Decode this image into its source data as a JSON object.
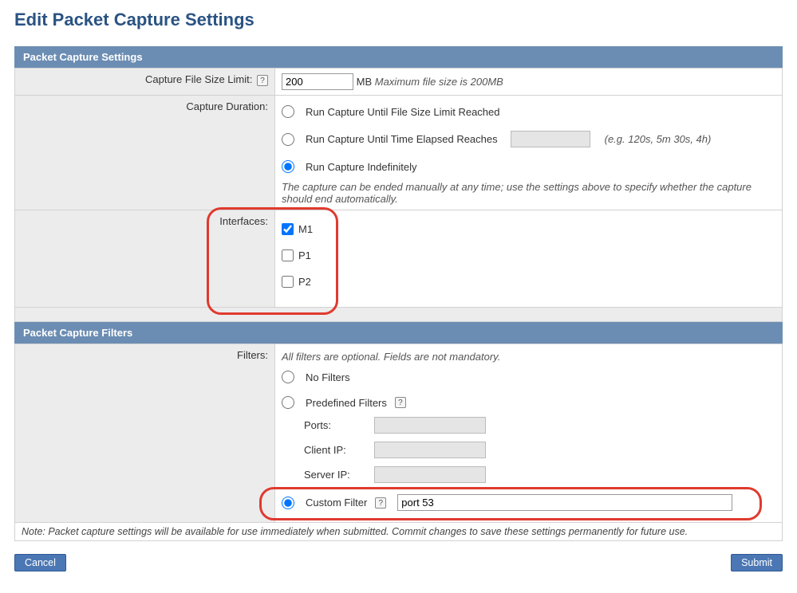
{
  "page": {
    "title": "Edit Packet Capture Settings"
  },
  "sections": {
    "settings_header": "Packet Capture Settings",
    "filters_header": "Packet Capture Filters"
  },
  "file_size": {
    "label": "Capture File Size Limit:",
    "value": "200",
    "unit": "MB",
    "hint": "Maximum file size is 200MB"
  },
  "duration": {
    "label": "Capture Duration:",
    "opt_limit": "Run Capture Until File Size Limit Reached",
    "opt_time": "Run Capture Until Time Elapsed Reaches",
    "time_hint": "(e.g. 120s, 5m 30s, 4h)",
    "opt_indef": "Run Capture Indefinitely",
    "note": "The capture can be ended manually at any time; use the settings above to specify whether the capture should end automatically."
  },
  "interfaces": {
    "label": "Interfaces:",
    "items": [
      {
        "name": "M1",
        "checked": true
      },
      {
        "name": "P1",
        "checked": false
      },
      {
        "name": "P2",
        "checked": false
      }
    ]
  },
  "filters": {
    "label": "Filters:",
    "intro": "All filters are optional. Fields are not mandatory.",
    "opt_none": "No Filters",
    "opt_predefined": "Predefined Filters",
    "ports_label": "Ports:",
    "client_ip_label": "Client IP:",
    "server_ip_label": "Server IP:",
    "opt_custom": "Custom Filter",
    "custom_value": "port 53"
  },
  "footer_note": "Note: Packet capture settings will be available for use immediately when submitted. Commit changes to save these settings permanently for future use.",
  "buttons": {
    "cancel": "Cancel",
    "submit": "Submit"
  }
}
